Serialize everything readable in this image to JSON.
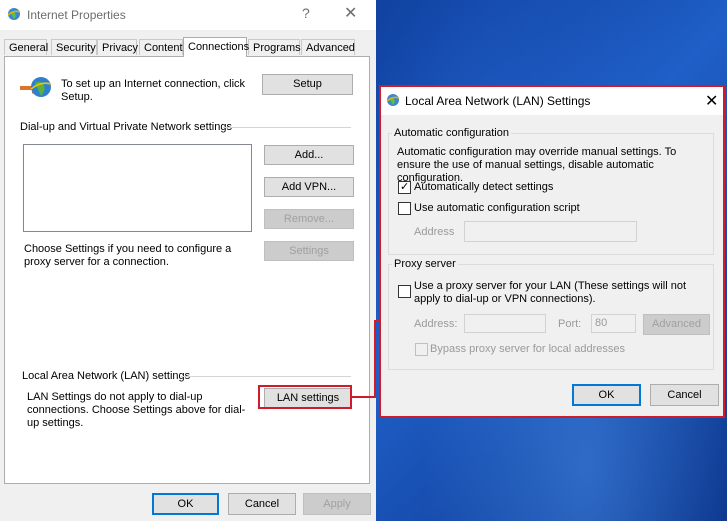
{
  "main_window": {
    "title": "Internet Properties",
    "help_glyph": "?",
    "close_glyph": "✕",
    "tabs": [
      "General",
      "Security",
      "Privacy",
      "Content",
      "Connections",
      "Programs",
      "Advanced"
    ],
    "active_tab": "Connections",
    "setup_text": "To set up an Internet connection, click Setup.",
    "setup_button": "Setup",
    "dialup_group": "Dial-up and Virtual Private Network settings",
    "add_button": "Add...",
    "add_vpn_button": "Add VPN...",
    "remove_button": "Remove...",
    "settings_button": "Settings",
    "proxy_hint": "Choose Settings if you need to configure a proxy server for a connection.",
    "lan_group": "Local Area Network (LAN) settings",
    "lan_text": "LAN Settings do not apply to dial-up connections. Choose Settings above for dial-up settings.",
    "lan_button": "LAN settings",
    "ok_button": "OK",
    "cancel_button": "Cancel",
    "apply_button": "Apply"
  },
  "lan_dialog": {
    "title": "Local Area Network (LAN) Settings",
    "close_glyph": "✕",
    "auto_config_legend": "Automatic configuration",
    "auto_config_desc": "Automatic configuration may override manual settings.  To ensure the use of manual settings, disable automatic configuration.",
    "auto_detect_label": "Automatically detect settings",
    "auto_detect_checked": true,
    "auto_script_label": "Use automatic configuration script",
    "auto_script_checked": false,
    "address_label": "Address",
    "address_value": "",
    "proxy_legend": "Proxy server",
    "use_proxy_label": "Use a proxy server for your LAN (These settings will not apply to dial-up or VPN connections).",
    "use_proxy_checked": false,
    "proxy_address_label": "Address:",
    "proxy_address_value": "",
    "port_label": "Port:",
    "port_value": "80",
    "advanced_button": "Advanced",
    "bypass_label": "Bypass proxy server for local addresses",
    "bypass_checked": false,
    "ok_button": "OK",
    "cancel_button": "Cancel"
  },
  "colors": {
    "highlight_red": "#d11a2a",
    "dialog_bg": "#f0f0f0",
    "default_button_border": "#0078d7"
  },
  "icons": {
    "window_icon": "internet-globe-icon",
    "setup_icon": "connection-wizard-globe-icon"
  }
}
